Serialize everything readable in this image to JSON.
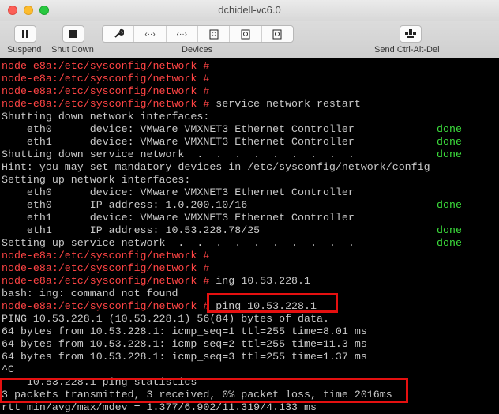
{
  "window": {
    "title": "dchidell-vc6.0"
  },
  "toolbar": {
    "suspend_label": "Suspend",
    "shutdown_label": "Shut Down",
    "devices_label": "Devices",
    "send_cad_label": "Send Ctrl-Alt-Del",
    "device_icons": [
      "wrench-icon",
      "network-icon",
      "network-icon",
      "disk-icon",
      "disk-icon",
      "disk-icon"
    ]
  },
  "terminal": {
    "prompt": "node-e8a:/etc/sysconfig/network #",
    "lines": [
      {
        "prompt": "node-e8a:/etc/sysconfig/network #",
        "text": ""
      },
      {
        "prompt": "node-e8a:/etc/sysconfig/network #",
        "text": ""
      },
      {
        "prompt": "node-e8a:/etc/sysconfig/network #",
        "text": ""
      },
      {
        "prompt": "node-e8a:/etc/sysconfig/network #",
        "text": " service network restart"
      },
      {
        "prompt": "",
        "text": "Shutting down network interfaces:"
      },
      {
        "prompt": "",
        "text": "    eth0      device: VMware VMXNET3 Ethernet Controller",
        "status": "done"
      },
      {
        "prompt": "",
        "text": "    eth1      device: VMware VMXNET3 Ethernet Controller",
        "status": "done"
      },
      {
        "prompt": "",
        "text": "Shutting down service network  .  .  .  .  .  .  .  .  .",
        "status": "done"
      },
      {
        "prompt": "",
        "text": "Hint: you may set mandatory devices in /etc/sysconfig/network/config"
      },
      {
        "prompt": "",
        "text": "Setting up network interfaces:"
      },
      {
        "prompt": "",
        "text": "    eth0      device: VMware VMXNET3 Ethernet Controller"
      },
      {
        "prompt": "",
        "text": "    eth0      IP address: 1.0.200.10/16",
        "status": "done"
      },
      {
        "prompt": "",
        "text": "    eth1      device: VMware VMXNET3 Ethernet Controller"
      },
      {
        "prompt": "",
        "text": "    eth1      IP address: 10.53.228.78/25",
        "status": "done"
      },
      {
        "prompt": "",
        "text": "Setting up service network  .  .  .  .  .  .  .  .  .  .",
        "status": "done"
      },
      {
        "prompt": "node-e8a:/etc/sysconfig/network #",
        "text": ""
      },
      {
        "prompt": "node-e8a:/etc/sysconfig/network #",
        "text": ""
      },
      {
        "prompt": "node-e8a:/etc/sysconfig/network #",
        "text": " ing 10.53.228.1"
      },
      {
        "prompt": "",
        "text": "bash: ing: command not found"
      },
      {
        "prompt": "node-e8a:/etc/sysconfig/network #",
        "text": " ping 10.53.228.1"
      },
      {
        "prompt": "",
        "text": "PING 10.53.228.1 (10.53.228.1) 56(84) bytes of data."
      },
      {
        "prompt": "",
        "text": "64 bytes from 10.53.228.1: icmp_seq=1 ttl=255 time=8.01 ms"
      },
      {
        "prompt": "",
        "text": "64 bytes from 10.53.228.1: icmp_seq=2 ttl=255 time=11.3 ms"
      },
      {
        "prompt": "",
        "text": "64 bytes from 10.53.228.1: icmp_seq=3 ttl=255 time=1.37 ms"
      },
      {
        "prompt": "",
        "text": "^C"
      },
      {
        "prompt": "",
        "text": "--- 10.53.228.1 ping statistics ---"
      },
      {
        "prompt": "",
        "text": "3 packets transmitted, 3 received, 0% packet loss, time 2016ms"
      },
      {
        "prompt": "",
        "text": "rtt min/avg/max/mdev = 1.377/6.902/11.319/4.133 ms"
      }
    ]
  },
  "colors": {
    "prompt": "#ff4444",
    "done": "#3cdc3c",
    "text": "#c9c9c9",
    "highlight": "#e51010"
  }
}
